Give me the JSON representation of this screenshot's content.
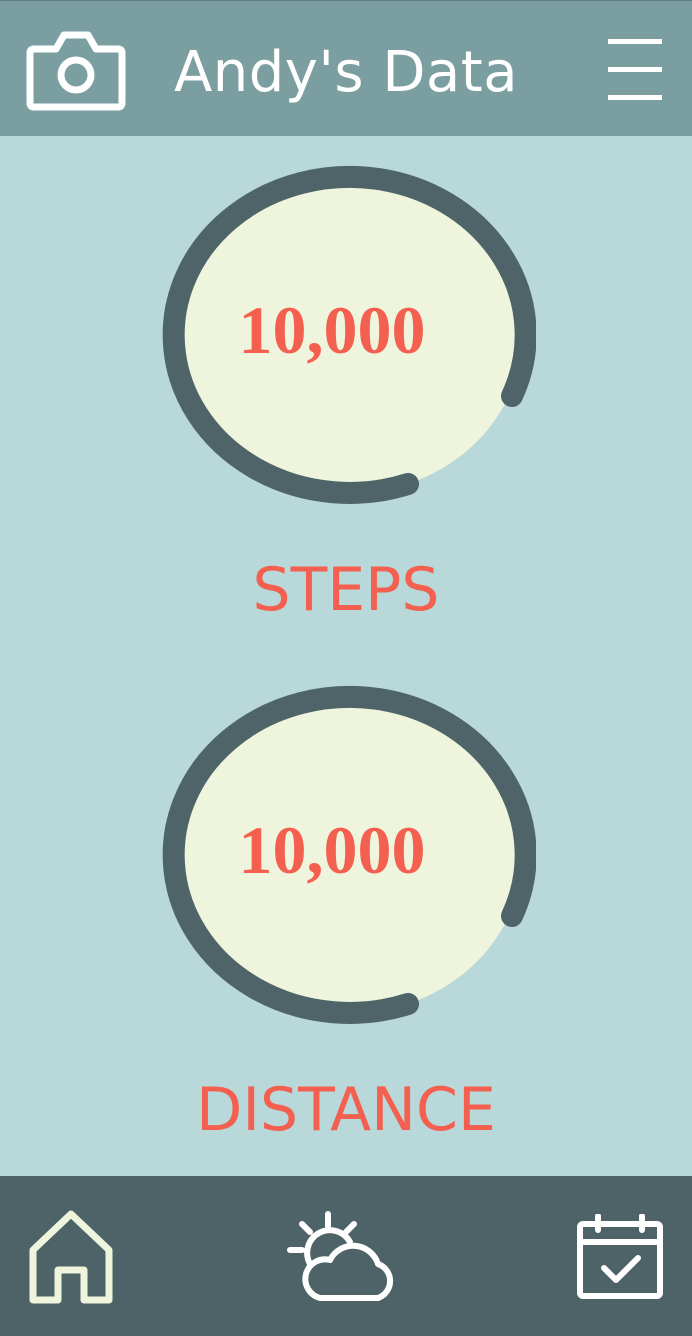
{
  "header": {
    "title": "Andy's Data",
    "left_icon": "camera-icon",
    "right_icon": "menu-icon"
  },
  "stats": [
    {
      "value": "10,000",
      "label": "STEPS",
      "progress": 0.78
    },
    {
      "value": "10,000",
      "label": "DISTANCE",
      "progress": 0.78
    }
  ],
  "footer": {
    "icons": [
      "home-icon",
      "weather-partly-cloudy-icon",
      "calendar-check-icon"
    ]
  },
  "colors": {
    "header_bg": "#7b9ea1",
    "page_bg": "#b8d8d9",
    "footer_bg": "#4e6367",
    "ring_track": "#4f6468",
    "ring_fill": "#eff4dc",
    "accent_text": "#f4604f",
    "header_text": "#ffffff",
    "home_icon": "#eff4dc"
  }
}
